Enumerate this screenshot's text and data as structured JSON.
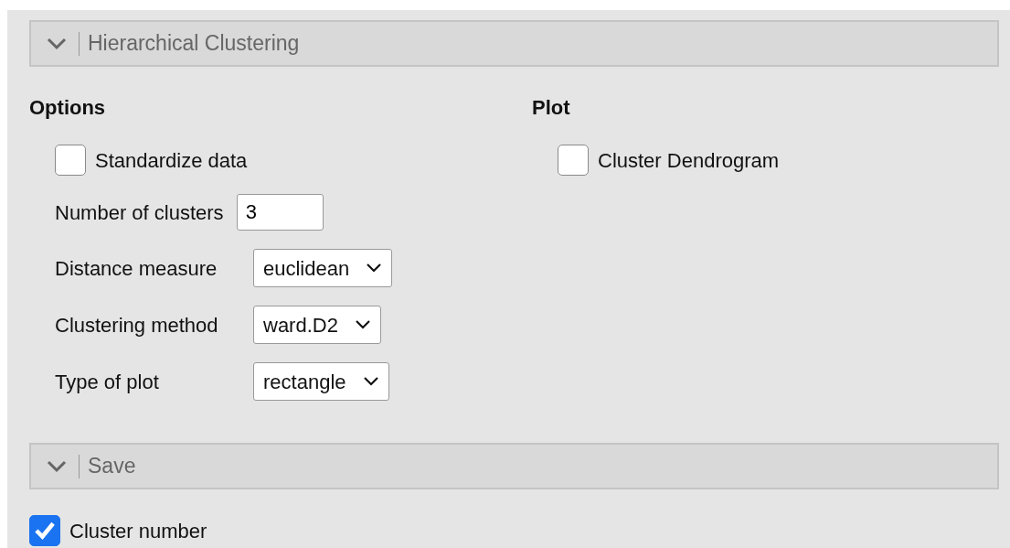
{
  "clustering_panel": {
    "title": "Hierarchical Clustering",
    "options": {
      "heading": "Options",
      "items": [
        {
          "kind": "checkbox",
          "label": "Standardize data",
          "checked": false
        },
        {
          "kind": "number",
          "label": "Number of clusters",
          "value": "3"
        },
        {
          "kind": "select",
          "label": "Distance measure",
          "value": "euclidean"
        },
        {
          "kind": "select",
          "label": "Clustering method",
          "value": "ward.D2"
        },
        {
          "kind": "select",
          "label": "Type of plot",
          "value": "rectangle"
        }
      ]
    },
    "plot": {
      "heading": "Plot",
      "items": [
        {
          "kind": "checkbox",
          "label": "Cluster Dendrogram",
          "checked": false
        }
      ]
    }
  },
  "save_panel": {
    "title": "Save",
    "items": [
      {
        "kind": "checkbox",
        "label": "Cluster number",
        "checked": true
      }
    ]
  }
}
